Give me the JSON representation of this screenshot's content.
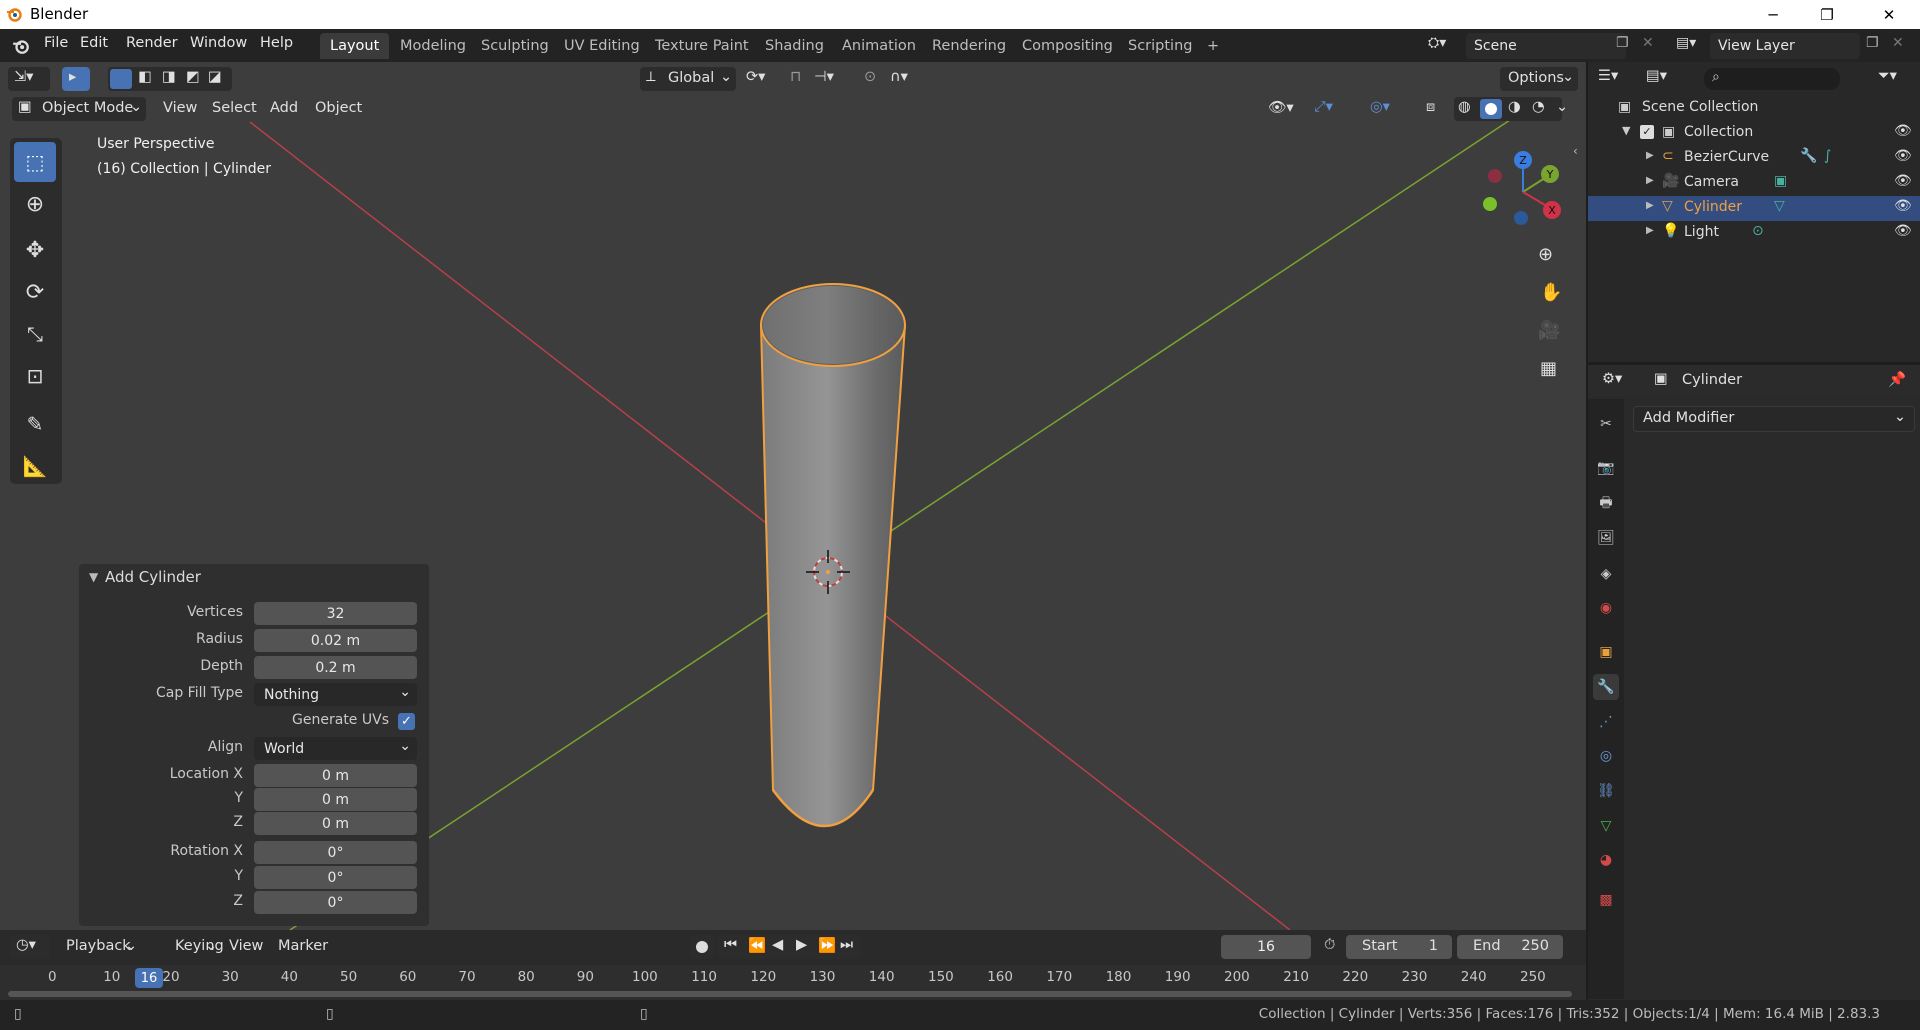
{
  "window": {
    "title": "Blender",
    "minimize": "─",
    "maximize": "❐",
    "close": "✕"
  },
  "menu": [
    "File",
    "Edit",
    "Render",
    "Window",
    "Help"
  ],
  "workspaces": [
    "Layout",
    "Modeling",
    "Sculpting",
    "UV Editing",
    "Texture Paint",
    "Shading",
    "Animation",
    "Rendering",
    "Compositing",
    "Scripting",
    "+"
  ],
  "active_workspace": "Layout",
  "scene_name": "Scene",
  "view_layer": "View Layer",
  "viewport": {
    "mode": "Object Mode",
    "menus": [
      "View",
      "Select",
      "Add",
      "Object"
    ],
    "transform_orientation": "Global",
    "options_label": "Options",
    "overlay_title": "User Perspective",
    "overlay_subtitle": "(16) Collection | Cylinder",
    "gizmo": {
      "x": "X",
      "y": "Y",
      "z": "Z"
    }
  },
  "operator_panel": {
    "title": "Add Cylinder",
    "fields": [
      {
        "label": "Vertices",
        "value": "32"
      },
      {
        "label": "Radius",
        "value": "0.02 m"
      },
      {
        "label": "Depth",
        "value": "0.2 m"
      }
    ],
    "cap_fill": {
      "label": "Cap Fill Type",
      "value": "Nothing"
    },
    "generate_uvs": {
      "label": "Generate UVs",
      "checked": true
    },
    "align": {
      "label": "Align",
      "value": "World"
    },
    "location": [
      {
        "label": "Location X",
        "value": "0 m"
      },
      {
        "label": "Y",
        "value": "0 m"
      },
      {
        "label": "Z",
        "value": "0 m"
      }
    ],
    "rotation": [
      {
        "label": "Rotation X",
        "value": "0°"
      },
      {
        "label": "Y",
        "value": "0°"
      },
      {
        "label": "Z",
        "value": "0°"
      }
    ]
  },
  "timeline": {
    "menus": [
      "Playback",
      "Keying",
      "View",
      "Marker"
    ],
    "current_frame": "16",
    "start_label": "Start",
    "start": "1",
    "end_label": "End",
    "end": "250",
    "ruler": [
      "0",
      "10",
      "20",
      "30",
      "40",
      "50",
      "60",
      "70",
      "80",
      "90",
      "100",
      "110",
      "120",
      "130",
      "140",
      "150",
      "160",
      "170",
      "180",
      "190",
      "200",
      "210",
      "220",
      "230",
      "240",
      "250"
    ]
  },
  "outliner": {
    "root": "Scene Collection",
    "collection": "Collection",
    "items": [
      {
        "name": "BezierCurve",
        "color": "#e8a040"
      },
      {
        "name": "Camera",
        "color": "#e8a040"
      },
      {
        "name": "Cylinder",
        "color": "#e8a040"
      },
      {
        "name": "Light",
        "color": "#e8a040"
      }
    ],
    "selected": "Cylinder"
  },
  "properties": {
    "object_name": "Cylinder",
    "add_modifier": "Add Modifier"
  },
  "status": "Collection | Cylinder | Verts:356 | Faces:176 | Tris:352 | Objects:1/4 | Mem: 16.4 MiB | 2.83.3",
  "colors": {
    "accent": "#4772b3",
    "selection": "#e8a040",
    "x_axis": "#b6404a",
    "y_axis": "#7aa330"
  }
}
